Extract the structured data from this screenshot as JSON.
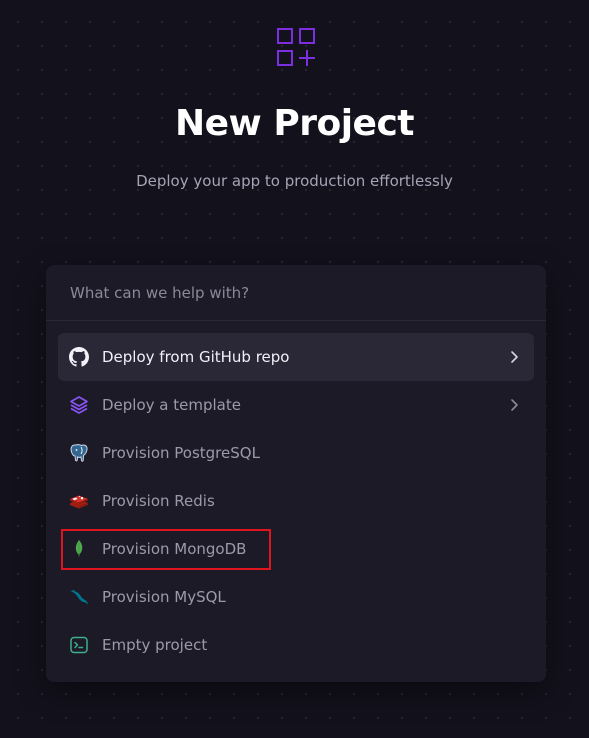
{
  "header": {
    "title": "New Project",
    "subtitle": "Deploy your app to production effortlessly",
    "logo_icon": "grid-plus-icon",
    "accent_color": "#7b2fe0"
  },
  "search": {
    "placeholder": "What can we help with?",
    "value": ""
  },
  "menu": [
    {
      "label": "Deploy from GitHub repo",
      "icon": "github-icon",
      "has_chevron": true,
      "active": true
    },
    {
      "label": "Deploy a template",
      "icon": "layers-icon",
      "has_chevron": true,
      "active": false
    },
    {
      "label": "Provision PostgreSQL",
      "icon": "postgresql-icon",
      "has_chevron": false,
      "active": false
    },
    {
      "label": "Provision Redis",
      "icon": "redis-icon",
      "has_chevron": false,
      "active": false
    },
    {
      "label": "Provision MongoDB",
      "icon": "mongodb-icon",
      "has_chevron": false,
      "active": false,
      "highlighted": true
    },
    {
      "label": "Provision MySQL",
      "icon": "mysql-icon",
      "has_chevron": false,
      "active": false
    },
    {
      "label": "Empty project",
      "icon": "terminal-icon",
      "has_chevron": false,
      "active": false
    }
  ],
  "colors": {
    "background": "#13111c",
    "card": "#1c1a27",
    "active_row": "#2a2836",
    "highlight_box": "#e0141e",
    "template_icon": "#8a55f7",
    "redis_icon": "#d3322a",
    "mongodb_icon": "#4fa94d",
    "mysql_icon": "#00758f",
    "terminal_icon": "#3fae8a"
  }
}
